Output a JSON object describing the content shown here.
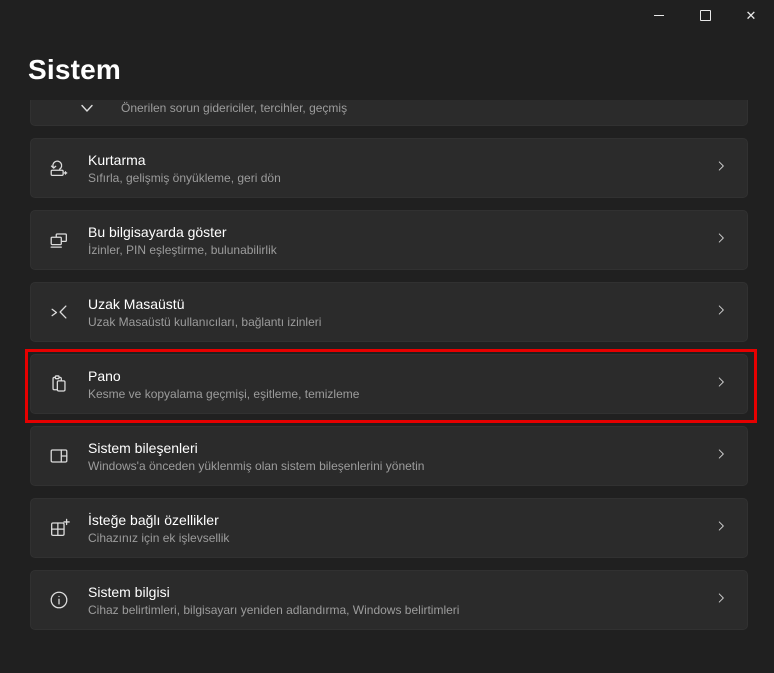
{
  "window": {
    "controls": {
      "minimize_label": "minimize",
      "maximize_label": "maximize",
      "close_glyph": "✕"
    }
  },
  "page": {
    "title": "Sistem"
  },
  "partial_item": {
    "subtitle": "Önerilen sorun gidericiler, tercihler, geçmiş",
    "icon": "chevron-down-icon"
  },
  "items": [
    {
      "title": "Kurtarma",
      "subtitle": "Sıfırla, gelişmiş önyükleme, geri dön",
      "icon": "recovery-icon",
      "highlighted": false
    },
    {
      "title": "Bu bilgisayarda göster",
      "subtitle": "İzinler, PIN eşleştirme, bulunabilirlik",
      "icon": "project-to-pc-icon",
      "highlighted": false
    },
    {
      "title": "Uzak Masaüstü",
      "subtitle": "Uzak Masaüstü kullanıcıları, bağlantı izinleri",
      "icon": "remote-desktop-icon",
      "highlighted": false
    },
    {
      "title": "Pano",
      "subtitle": "Kesme ve kopyalama geçmişi, eşitleme, temizleme",
      "icon": "clipboard-icon",
      "highlighted": true
    },
    {
      "title": "Sistem bileşenleri",
      "subtitle": "Windows'a önceden yüklenmiş olan sistem bileşenlerini yönetin",
      "icon": "system-components-icon",
      "highlighted": false
    },
    {
      "title": "İsteğe bağlı özellikler",
      "subtitle": "Cihazınız için ek işlevsellik",
      "icon": "optional-features-icon",
      "highlighted": false
    },
    {
      "title": "Sistem bilgisi",
      "subtitle": "Cihaz belirtimleri, bilgisayarı yeniden adlandırma, Windows belirtimleri",
      "icon": "info-icon",
      "highlighted": false
    }
  ],
  "colors": {
    "background": "#202020",
    "card": "#2b2b2b",
    "text_primary": "#ffffff",
    "text_secondary": "#9c9c9c",
    "highlight": "#e60000"
  }
}
